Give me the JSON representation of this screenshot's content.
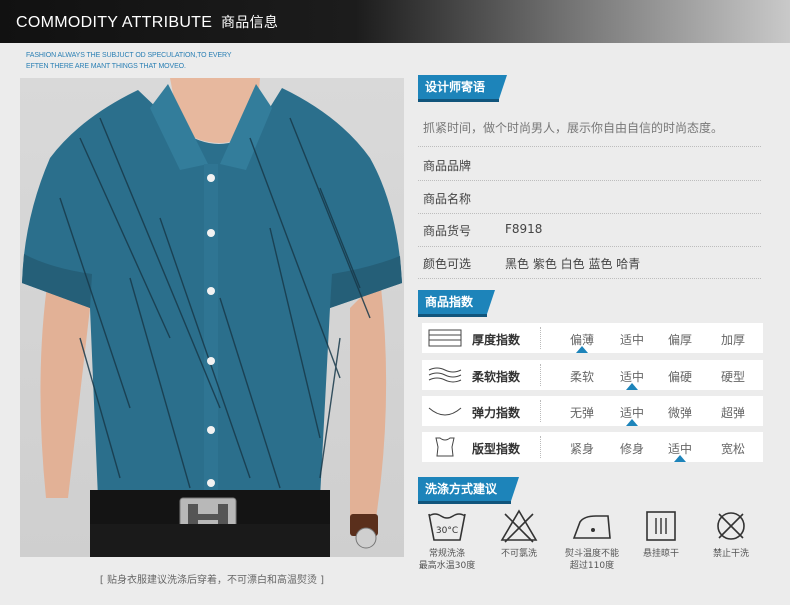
{
  "header": {
    "title_en": "COMMODITY ATTRIBUTE",
    "title_cn": "商品信息",
    "slogan_line1": "FASHION ALWAYS THE  SUBJUCT OD SPECULATION,TO EVERY",
    "slogan_line2": "EFTEN THERE ARE MANT THINGS THAT MOVEO."
  },
  "photo": {
    "caption": "[   贴身衣服建议洗涤后穿着，不可漂白和高温熨烫   ]"
  },
  "designer": {
    "heading": "设计师寄语",
    "message": "抓紧时间，做个时尚男人，展示你自由自信的时尚态度。"
  },
  "attributes": [
    {
      "label": "商品品牌",
      "value": ""
    },
    {
      "label": "商品名称",
      "value": ""
    },
    {
      "label": "商品货号",
      "value": "F8918"
    },
    {
      "label": "颜色可选",
      "value": "黑色 紫色 白色 蓝色 哈青"
    }
  ],
  "index": {
    "heading": "商品指数",
    "rows": [
      {
        "label": "厚度指数",
        "icon": "thickness-icon",
        "options": [
          "偏薄",
          "适中",
          "偏厚",
          "加厚"
        ],
        "selected": 0
      },
      {
        "label": "柔软指数",
        "icon": "softness-icon",
        "options": [
          "柔软",
          "适中",
          "偏硬",
          "硬型"
        ],
        "selected": 1
      },
      {
        "label": "弹力指数",
        "icon": "elasticity-icon",
        "options": [
          "无弹",
          "适中",
          "微弹",
          "超弹"
        ],
        "selected": 1
      },
      {
        "label": "版型指数",
        "icon": "fit-icon",
        "options": [
          "紧身",
          "修身",
          "适中",
          "宽松"
        ],
        "selected": 2
      }
    ]
  },
  "washing": {
    "heading": "洗涤方式建议",
    "items": [
      {
        "icon": "wash-30-icon",
        "temp": "30°C",
        "line1": "常规洗涤",
        "line2": "最高水温30度"
      },
      {
        "icon": "no-bleach-icon",
        "line1": "不可氯洗",
        "line2": ""
      },
      {
        "icon": "iron-icon",
        "line1": "熨斗温度不能",
        "line2": "超过110度"
      },
      {
        "icon": "hang-dry-icon",
        "line1": "悬挂晾干",
        "line2": ""
      },
      {
        "icon": "no-tumble-dry-icon",
        "line1": "禁止干洗",
        "line2": ""
      }
    ]
  },
  "colors": {
    "accent": "#1d84ba",
    "shirt": "#2b6f8c"
  }
}
